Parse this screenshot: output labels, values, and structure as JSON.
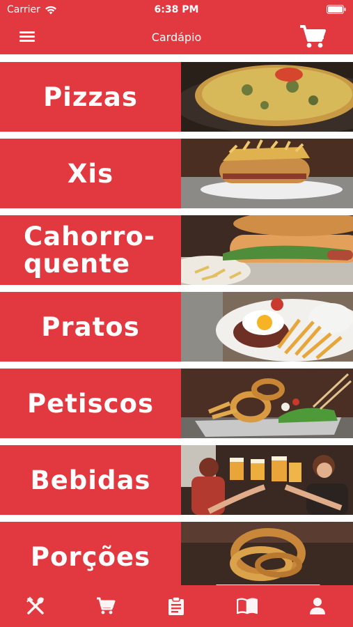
{
  "status_bar": {
    "carrier": "Carrier",
    "time": "6:38 PM"
  },
  "header": {
    "title": "Cardápio"
  },
  "colors": {
    "primary": "#e2383f",
    "background": "#ffffff",
    "text": "#ffffff"
  },
  "categories": [
    {
      "label": "Pizzas",
      "image": "pizza-photo"
    },
    {
      "label": "Xis",
      "image": "burger-photo"
    },
    {
      "label": "Cahorro-\nquente",
      "image": "hotdog-photo"
    },
    {
      "label": "Pratos",
      "image": "plate-photo"
    },
    {
      "label": "Petiscos",
      "image": "snacks-photo"
    },
    {
      "label": "Bebidas",
      "image": "drinks-photo"
    },
    {
      "label": "Porções",
      "image": "portions-photo"
    }
  ],
  "tabbar": [
    {
      "icon": "utensils-icon"
    },
    {
      "icon": "cart-icon"
    },
    {
      "icon": "clipboard-icon"
    },
    {
      "icon": "book-icon"
    },
    {
      "icon": "user-icon"
    }
  ]
}
